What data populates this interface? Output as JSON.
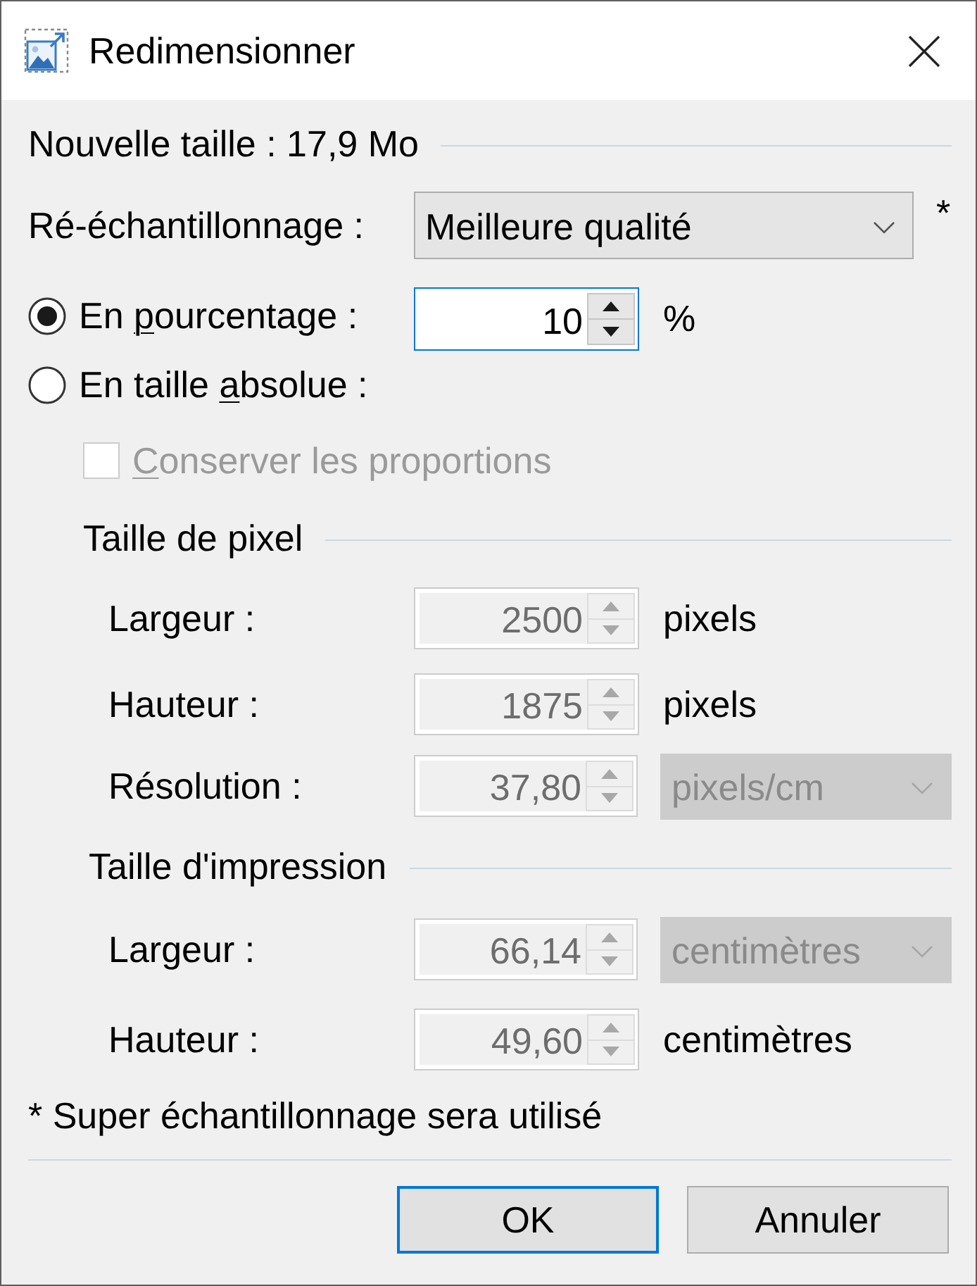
{
  "window": {
    "title": "Redimensionner"
  },
  "new_size": {
    "label": "Nouvelle taille : 17,9 Mo"
  },
  "resampling": {
    "label": "Ré-échantillonnage :",
    "value": "Meilleure qualité",
    "note_mark": "*"
  },
  "modes": [
    {
      "label_start": "En ",
      "access_key": "p",
      "label_end": "ourcentage :",
      "selected": true,
      "field": {
        "value": "10",
        "focused": true
      },
      "unit": "%"
    },
    {
      "label_start": "En taille ",
      "access_key": "a",
      "label_end": "bsolue :",
      "selected": false
    }
  ],
  "keep_proportions": {
    "access_key": "C",
    "label_end": "onserver les proportions",
    "checked": false,
    "disabled": true
  },
  "pixel_size": {
    "title": "Taille de pixel",
    "rows": [
      {
        "label": "Largeur :",
        "value": "2500",
        "disabled": true,
        "unit": {
          "kind": "text",
          "value": "pixels"
        }
      },
      {
        "label": "Hauteur :",
        "value": "1875",
        "disabled": true,
        "unit": {
          "kind": "text",
          "value": "pixels"
        }
      },
      {
        "label": "Résolution :",
        "value": "37,80",
        "disabled": true,
        "unit": {
          "kind": "dropdown",
          "value": "pixels/cm",
          "disabled": true
        }
      }
    ]
  },
  "print_size": {
    "title": "Taille d'impression",
    "rows": [
      {
        "label": "Largeur :",
        "value": "66,14",
        "disabled": true,
        "unit": {
          "kind": "dropdown",
          "value": "centimètres",
          "disabled": true
        }
      },
      {
        "label": "Hauteur :",
        "value": "49,60",
        "disabled": true,
        "unit": {
          "kind": "text",
          "value": "centimètres"
        }
      }
    ]
  },
  "footnote": "* Super échantillonnage sera utilisé",
  "buttons": [
    {
      "label": "OK",
      "default": true
    },
    {
      "label": "Annuler",
      "default": false
    }
  ]
}
